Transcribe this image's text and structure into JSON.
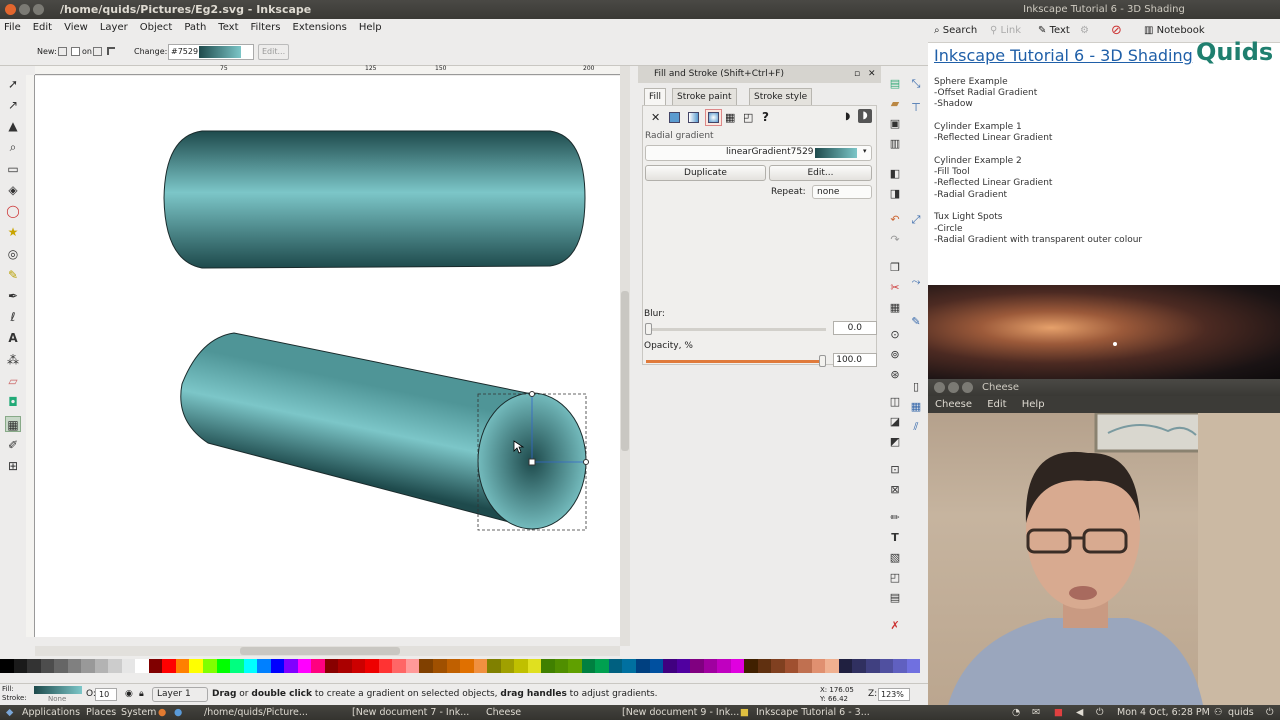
{
  "inkscape": {
    "title": "/home/quids/Pictures/Eg2.svg - Inkscape",
    "menu": [
      "File",
      "Edit",
      "View",
      "Layer",
      "Object",
      "Path",
      "Text",
      "Filters",
      "Extensions",
      "Help"
    ],
    "toolctrl": {
      "new_label": "New:",
      "on_label": "on",
      "change_label": "Change:",
      "gradient_id": "#7529",
      "edit_label": "Edit..."
    },
    "ruler_ticks": [
      "75",
      "125",
      "150",
      "200"
    ],
    "status": {
      "fill_label": "Fill:",
      "stroke_label": "Stroke:",
      "stroke_value": "None",
      "opacity_label": "O:",
      "opacity_value": "10",
      "layer": "Layer 1",
      "message_b1": "Drag",
      "message_t1": " or ",
      "message_b2": "double click",
      "message_t2": " to create a gradient on selected objects, ",
      "message_b3": "drag handles",
      "message_t3": " to adjust gradients.",
      "x_label": "X:",
      "x_value": "176.05",
      "y_label": "Y:",
      "y_value": "66.42",
      "zoom_label": "Z:",
      "zoom_value": "123%"
    }
  },
  "fill_stroke": {
    "title": "Fill and Stroke (Shift+Ctrl+F)",
    "tabs": [
      "Fill",
      "Stroke paint",
      "Stroke style"
    ],
    "paint_kind": "Radial gradient",
    "gradient_name": "linearGradient7529",
    "duplicate_label": "Duplicate",
    "edit_label": "Edit...",
    "repeat_label": "Repeat:",
    "repeat_value": "none",
    "blur_label": "Blur:",
    "blur_value": "0.0",
    "blur_fraction": 0.0,
    "opacity_label": "Opacity, %",
    "opacity_value": "100.0",
    "opacity_fraction": 1.0
  },
  "notebook": {
    "window_title": "Inkscape Tutorial 6 - 3D Shading",
    "toolbar": [
      "Search",
      "Link",
      "Text",
      "Notebook"
    ],
    "page_title": "Inkscape Tutorial 6 - 3D Shading",
    "brand": "Quids",
    "lines": [
      "Sphere Example",
      "-Offset Radial Gradient",
      "-Shadow",
      "Cylinder Example 1",
      "-Reflected Linear Gradient",
      "Cylinder Example 2",
      "-Fill Tool",
      "-Reflected Linear Gradient",
      "-Radial Gradient",
      "Tux Light Spots",
      "-Circle",
      "-Radial Gradient with transparent outer colour"
    ]
  },
  "cheese": {
    "title": "Cheese",
    "menu": [
      "Cheese",
      "Edit",
      "Help"
    ]
  },
  "panel": {
    "menus": [
      "Applications",
      "Places",
      "System"
    ],
    "tasks": [
      "/home/quids/Picture...",
      "[New document 7 - Ink...",
      "Cheese",
      "[New document 9 - Ink...",
      "Inkscape Tutorial 6 - 3..."
    ],
    "clock": "Mon 4 Oct, 6:28 PM",
    "user": "quids"
  },
  "colors": {
    "cylinder_dark": "#1e4a4c",
    "cylinder_light": "#7cc6c8",
    "accent": "#e07a3b",
    "link": "#1f5fa8"
  }
}
